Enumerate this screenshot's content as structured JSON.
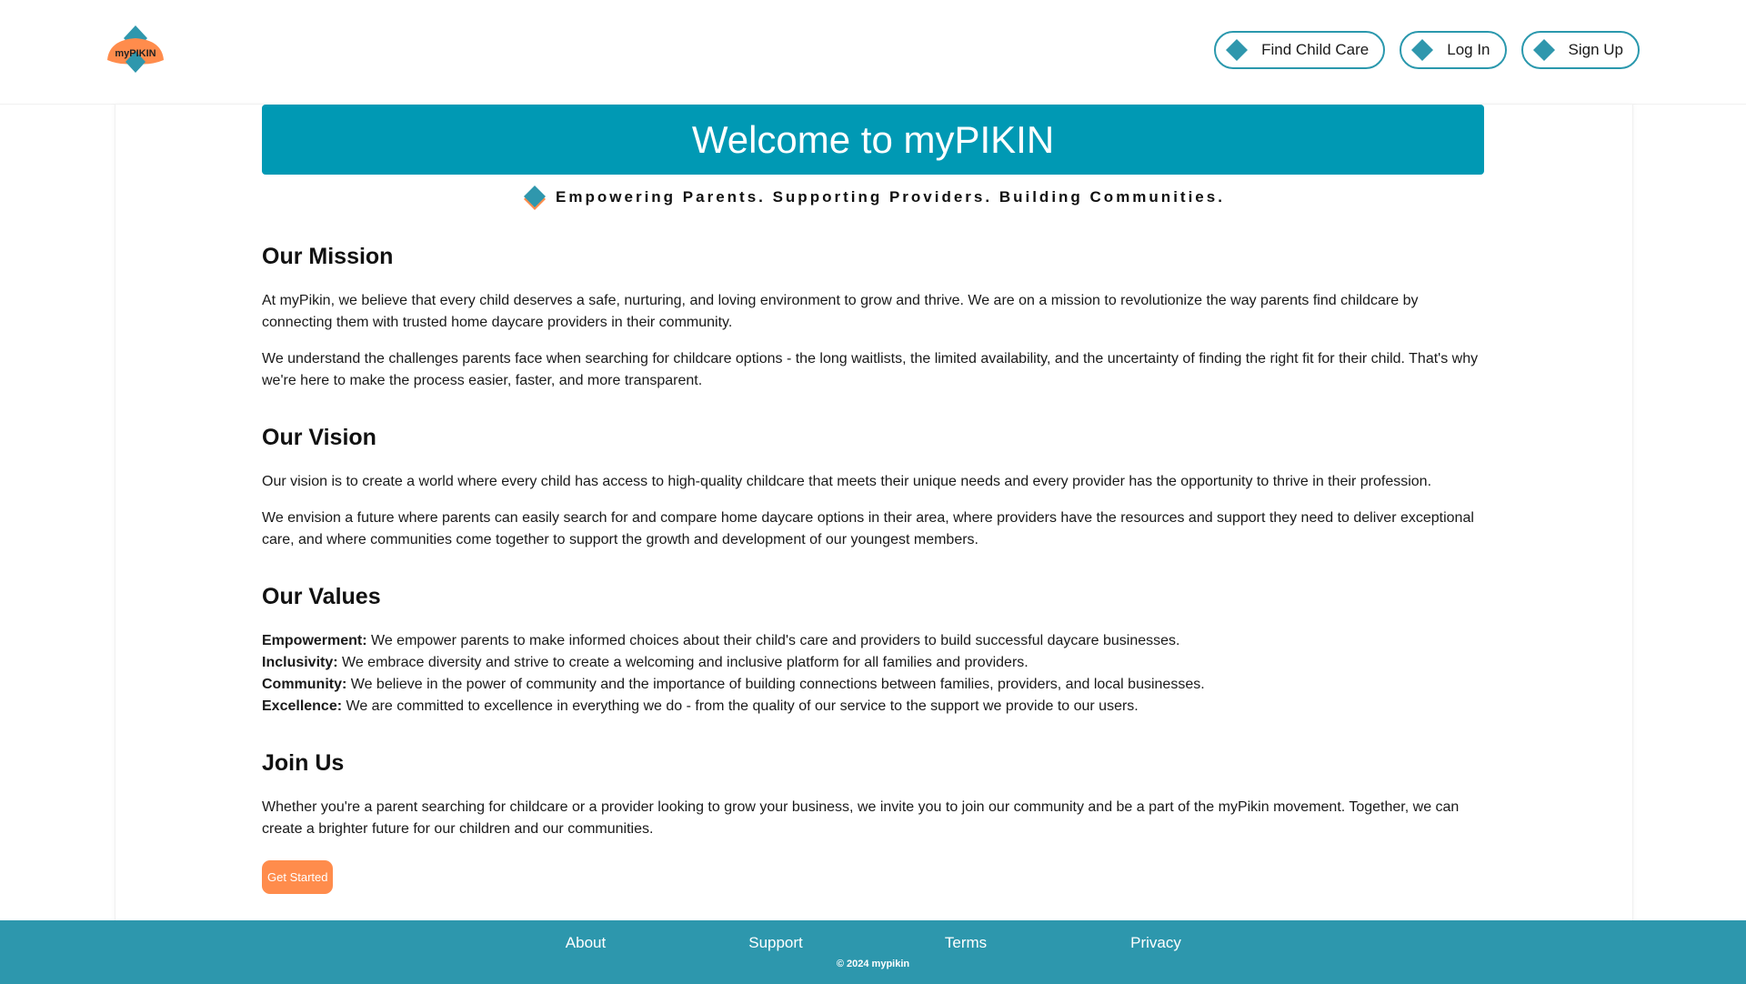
{
  "header": {
    "logo_text": "myPIKIN",
    "nav": [
      {
        "label": "Find Child Care",
        "icon": "diamond-icon"
      },
      {
        "label": "Log In",
        "icon": "diamond-icon"
      },
      {
        "label": "Sign Up",
        "icon": "diamond-icon"
      }
    ]
  },
  "banner": {
    "title": "Welcome to myPIKIN"
  },
  "tagline": "Empowering Parents. Supporting Providers. Building Communities.",
  "mission": {
    "heading": "Our Mission",
    "p1": "At myPikin, we believe that every child deserves a safe, nurturing, and loving environment to grow and thrive. We are on a mission to revolutionize the way parents find childcare by connecting them with trusted home daycare providers in their community.",
    "p2": "We understand the challenges parents face when searching for childcare options - the long waitlists, the limited availability, and the uncertainty of finding the right fit for their child. That's why we're here to make the process easier, faster, and more transparent."
  },
  "vision": {
    "heading": "Our Vision",
    "p1": "Our vision is to create a world where every child has access to high-quality childcare that meets their unique needs and every provider has the opportunity to thrive in their profession.",
    "p2": "We envision a future where parents can easily search for and compare home daycare options in their area, where providers have the resources and support they need to deliver exceptional care, and where communities come together to support the growth and development of our youngest members."
  },
  "values": {
    "heading": "Our Values",
    "items": [
      {
        "term": "Empowerment:",
        "text": " We empower parents to make informed choices about their child's care and providers to build successful daycare businesses."
      },
      {
        "term": "Inclusivity:",
        "text": " We embrace diversity and strive to create a welcoming and inclusive platform for all families and providers."
      },
      {
        "term": "Community:",
        "text": " We believe in the power of community and the importance of building connections between families, providers, and local businesses."
      },
      {
        "term": "Excellence:",
        "text": " We are committed to excellence in everything we do - from the quality of our service to the support we provide to our users."
      }
    ]
  },
  "join": {
    "heading": "Join Us",
    "p1": "Whether you're a parent searching for childcare or a provider looking to grow your business, we invite you to join our community and be a part of the myPikin movement. Together, we can create a brighter future for our children and our communities.",
    "cta": "Get Started"
  },
  "footer": {
    "links": [
      "About",
      "Support",
      "Terms",
      "Privacy"
    ],
    "copyright": "© 2024 mypikin"
  },
  "colors": {
    "teal": "#0099b4",
    "footer_teal": "#2d97ad",
    "orange": "#ff8c4c"
  }
}
